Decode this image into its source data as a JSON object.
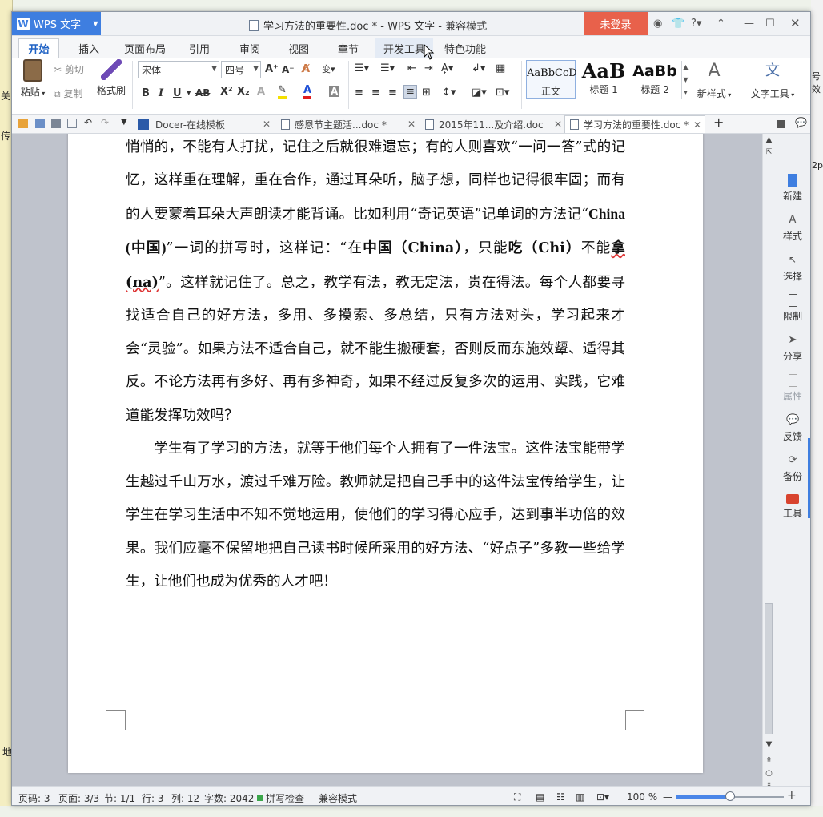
{
  "app": {
    "name": "WPS 文字",
    "title": "学习方法的重要性.doc * - WPS 文字 - 兼容模式",
    "login": "未登录"
  },
  "ribbon_tabs": [
    "开始",
    "插入",
    "页面布局",
    "引用",
    "审阅",
    "视图",
    "章节",
    "开发工具",
    "特色功能"
  ],
  "ribbon": {
    "paste": "粘贴",
    "cut": "剪切",
    "copy": "复制",
    "format_painter": "格式刷",
    "font_name": "宋体",
    "font_size": "四号",
    "styles": [
      {
        "sample": "AaBbCcD",
        "label": "正文"
      },
      {
        "sample": "AaB",
        "label": "标题 1"
      },
      {
        "sample": "AaBb",
        "label": "标题 2"
      }
    ],
    "new_style": "新样式",
    "text_tools": "文字工具"
  },
  "doc_tabs": [
    {
      "label": "Docer-在线模板",
      "active": false
    },
    {
      "label": "感恩节主题活...doc *",
      "active": false
    },
    {
      "label": "2015年11...及介绍.doc",
      "active": false
    },
    {
      "label": "学习方法的重要性.doc *",
      "active": true
    }
  ],
  "document": {
    "p1": "那种方法比较好，要看你到底适应哪种方法；比如背诵课文，有的人要默读，静悄悄的，不能有人打扰，记住之后就很难遗忘；有的人则喜欢“一问一答”式的记忆，这样重在理解，重在合作，通过耳朵听，脑子想，同样也记得很牢固；而有的人要蒙着耳朵大声朗读才能背诵。比如利用“奇记英语”记单词的方法记“",
    "p1_b1": "China (中国)",
    "p1_t2": "”一词的拼写时，这样记：“在",
    "p1_b2": "中国（China）",
    "p1_t3": "，只能",
    "p1_b3": "吃（Chi）",
    "p1_t4": "不能",
    "p1_b4": "拿(na)",
    "p1_t5": "”。这样就记住了。总之，教学有法，教无定法，贵在得法。每个人都要寻找适合自己的好方法，多用、多摸索、多总结，只有方法对头，学习起来才会“灵验”。如果方法不适合自己，就不能生搬硬套，否则反而东施效颦、适得其反。不论方法再有多好、再有多神奇，如果不经过反复多次的运用、实践，它难道能发挥功效吗？",
    "p2": "学生有了学习的方法，就等于他们每个人拥有了一件法宝。这件法宝能带学生越过千山万水，渡过千难万险。教师就是把自己手中的这件法宝传给学生，让学生在学习生活中不知不觉地运用，使他们的学习得心应手，达到事半功倍的效果。我们应毫不保留地把自己读书时候所采用的好方法、“好点子”多教一些给学生，让他们也成为优秀的人才吧！"
  },
  "sidebar": [
    "新建",
    "样式",
    "选择",
    "限制",
    "分享",
    "属性",
    "反馈",
    "备份",
    "工具"
  ],
  "status": {
    "page_no": "页码: 3",
    "pages": "页面: 3/3",
    "section": "节: 1/1",
    "row": "行: 3",
    "col": "列: 12",
    "words": "字数: 2042",
    "spell": "拼写检查",
    "mode": "兼容模式",
    "zoom": "100 %",
    "zoom_level": 0.5
  },
  "background": {
    "left_frags": [
      "关",
      "传",
      "地"
    ],
    "right_frags": [
      "号效",
      "2p"
    ]
  },
  "colors": {
    "accent": "#3e7ee0",
    "login": "#e8614b",
    "workspace": "#bfc3cc"
  }
}
